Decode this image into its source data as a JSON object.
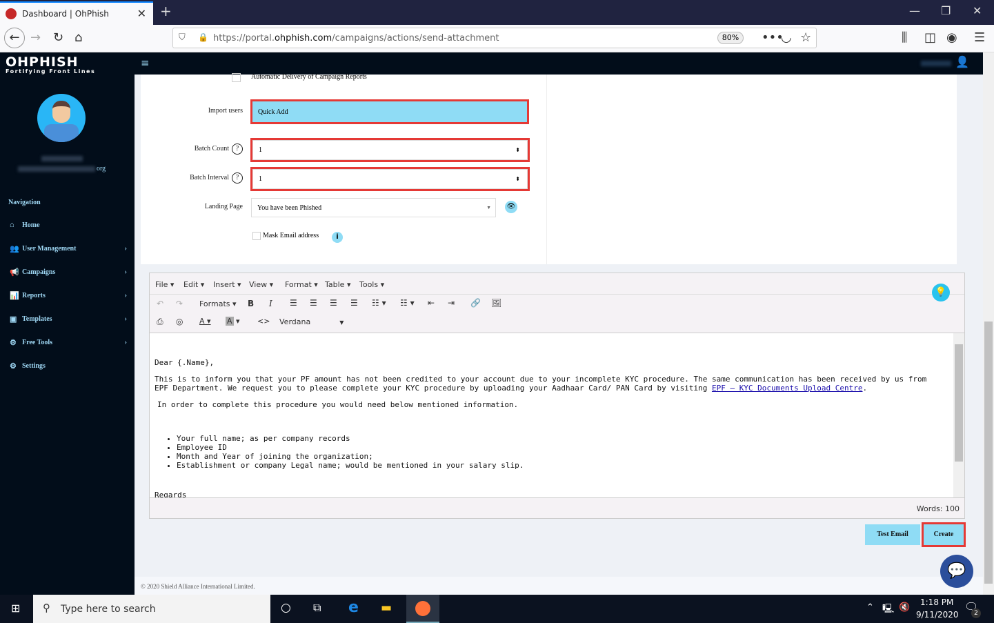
{
  "browser": {
    "tab_title": "Dashboard | OhPhish",
    "url_prefix": "https://portal.",
    "url_domain": "ohphish.com",
    "url_path": "/campaigns/actions/send-attachment",
    "zoom": "80%"
  },
  "app": {
    "logo": "OHPHISH",
    "tagline": "Fortifying Front Lines",
    "user_email_suffix": "org"
  },
  "sidebar": {
    "heading": "Navigation",
    "items": [
      {
        "label": "Home",
        "icon": "home-icon",
        "glyph": "⌂",
        "chev": false
      },
      {
        "label": "User Management",
        "icon": "users-icon",
        "glyph": "👥",
        "chev": true
      },
      {
        "label": "Campaigns",
        "icon": "megaphone-icon",
        "glyph": "📢",
        "chev": true
      },
      {
        "label": "Reports",
        "icon": "chart-icon",
        "glyph": "📊",
        "chev": true
      },
      {
        "label": "Templates",
        "icon": "template-icon",
        "glyph": "▣",
        "chev": true
      },
      {
        "label": "Free Tools",
        "icon": "tools-icon",
        "glyph": "⚙",
        "chev": true
      },
      {
        "label": "Settings",
        "icon": "settings-icon",
        "glyph": "⚙",
        "chev": false
      }
    ]
  },
  "form": {
    "auto_delivery": "Automatic Delivery of Campaign Reports",
    "import_users_label": "Import users",
    "import_users_value": "Quick Add",
    "batch_count_label": "Batch Count",
    "batch_count_value": "1",
    "batch_interval_label": "Batch Interval",
    "batch_interval_value": "1",
    "landing_page_label": "Landing Page",
    "landing_page_value": "You have been Phished",
    "mask_email_label": "Mask Email address"
  },
  "editor": {
    "menus": [
      "File",
      "Edit",
      "Insert",
      "View",
      "Format",
      "Table",
      "Tools"
    ],
    "formats": "Formats",
    "font": "Verdana",
    "greeting": "Dear {.Name},",
    "para1": "This is to inform you that your PF amount has not been credited to your account due to your incomplete KYC procedure. The same communication has been received by us from EPF Department. We request you to please complete your KYC procedure by uploading your Aadhaar Card/ PAN Card by visiting ",
    "link": "EPF – KYC Documents Upload Centre",
    "para2": "In order to complete this procedure you would need below mentioned information.",
    "bullets": [
      "Your full name; as per company records",
      "Employee ID",
      "Month and Year of joining the organization;",
      "Establishment or company Legal name; would be mentioned in your salary slip."
    ],
    "closing": "Regards",
    "word_count": "Words: 100"
  },
  "buttons": {
    "test_email": "Test Email",
    "create": "Create"
  },
  "footer": "© 2020 Shield Alliance International Limited.",
  "taskbar": {
    "search_placeholder": "Type here to search",
    "time": "1:18 PM",
    "date": "9/11/2020",
    "notifications": "2"
  },
  "colors": {
    "accent": "#8fdcf5",
    "highlight": "#e53935",
    "sidebar": "#020d1a"
  }
}
